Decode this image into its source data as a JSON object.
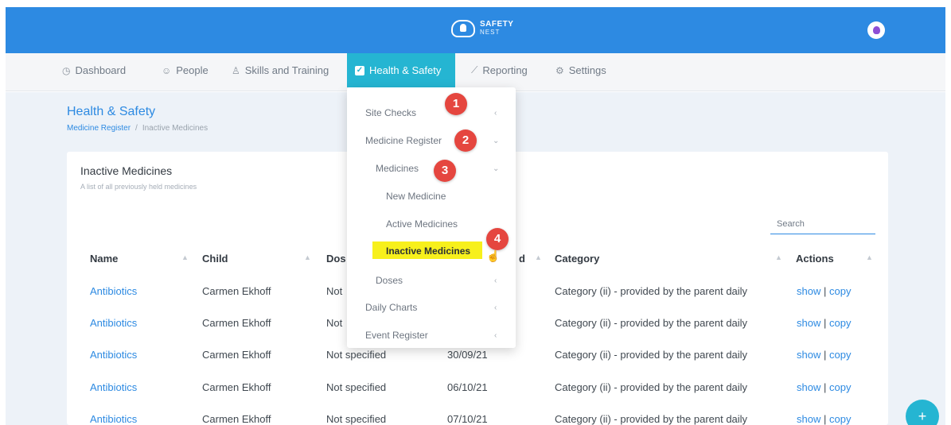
{
  "brand": {
    "line1": "SAFETY",
    "line2": "NEST"
  },
  "nav": {
    "dashboard": "Dashboard",
    "people": "People",
    "skills": "Skills and Training",
    "health": "Health & Safety",
    "reporting": "Reporting",
    "settings": "Settings"
  },
  "page": {
    "title": "Health & Safety",
    "breadcrumb_link": "Medicine Register",
    "breadcrumb_current": "Inactive Medicines"
  },
  "card": {
    "title": "Inactive Medicines",
    "subtitle": "A list of all previously held medicines"
  },
  "search": {
    "placeholder": "Search"
  },
  "table": {
    "headers": [
      "Name",
      "Child",
      "Dos",
      "d",
      "Category",
      "Actions"
    ],
    "rows": [
      {
        "name": "Antibiotics",
        "child": "Carmen Ekhoff",
        "dose": "Not",
        "date": "",
        "category": "Category (ii) - provided by the parent daily"
      },
      {
        "name": "Antibiotics",
        "child": "Carmen Ekhoff",
        "dose": "Not",
        "date": "",
        "category": "Category (ii) - provided by the parent daily"
      },
      {
        "name": "Antibiotics",
        "child": "Carmen Ekhoff",
        "dose": "Not specified",
        "date": "30/09/21",
        "category": "Category (ii) - provided by the parent daily"
      },
      {
        "name": "Antibiotics",
        "child": "Carmen Ekhoff",
        "dose": "Not specified",
        "date": "06/10/21",
        "category": "Category (ii) - provided by the parent daily"
      },
      {
        "name": "Antibiotics",
        "child": "Carmen Ekhoff",
        "dose": "Not specified",
        "date": "07/10/21",
        "category": "Category (ii) - provided by the parent daily"
      }
    ],
    "action_show": "show",
    "action_sep": "|",
    "action_copy": "copy"
  },
  "dropdown": {
    "site_checks": "Site Checks",
    "medicine_register": "Medicine Register",
    "medicines": "Medicines",
    "new_medicine": "New Medicine",
    "active_medicines": "Active Medicines",
    "inactive_medicines": "Inactive Medicines",
    "doses": "Doses",
    "daily_charts": "Daily Charts",
    "event_register": "Event Register"
  },
  "badges": [
    "1",
    "2",
    "3",
    "4"
  ],
  "fab": "+"
}
